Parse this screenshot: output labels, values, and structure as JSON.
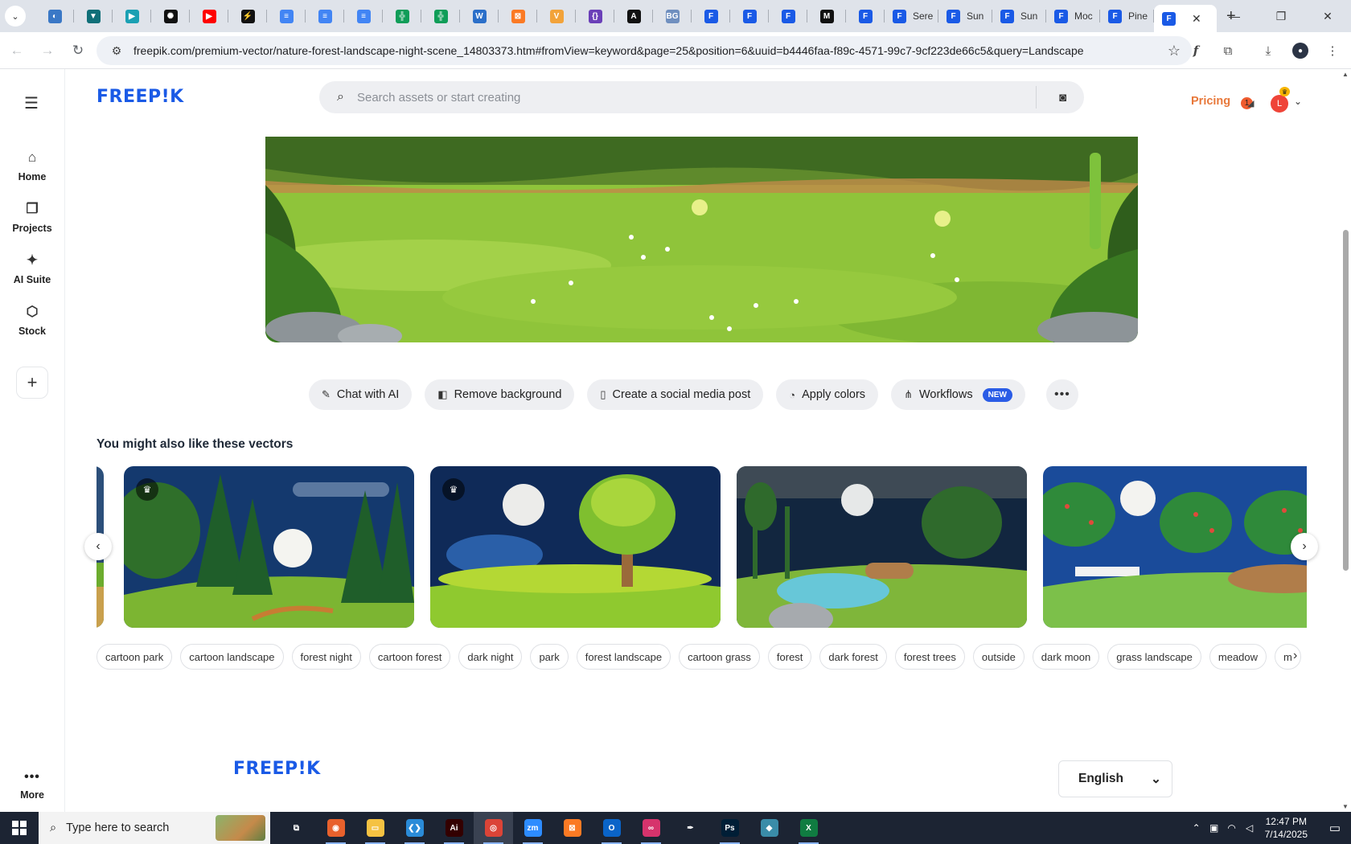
{
  "browser": {
    "pinned_tabs": [
      {
        "icon": "globe-icon",
        "color": "#3a78c6",
        "glyph": "◐"
      },
      {
        "icon": "shield-icon",
        "color": "#0f6f78",
        "glyph": "▼"
      },
      {
        "icon": "arrow-icon",
        "color": "#1aa0b3",
        "glyph": "▶"
      },
      {
        "icon": "openai-icon",
        "color": "#111111",
        "glyph": "✺"
      },
      {
        "icon": "youtube-icon",
        "color": "#ff0000",
        "glyph": "▶"
      },
      {
        "icon": "bolt-icon",
        "color": "#111111",
        "glyph": "⚡"
      },
      {
        "icon": "docs-icon",
        "color": "#4285f4",
        "glyph": "≡"
      },
      {
        "icon": "docs-icon",
        "color": "#4285f4",
        "glyph": "≡"
      },
      {
        "icon": "docs-icon",
        "color": "#4285f4",
        "glyph": "≡"
      },
      {
        "icon": "sheets-icon",
        "color": "#0f9d58",
        "glyph": "╬"
      },
      {
        "icon": "sheets-icon",
        "color": "#0f9d58",
        "glyph": "╬"
      },
      {
        "icon": "word-icon",
        "color": "#2b6fc9",
        "glyph": "W"
      },
      {
        "icon": "xampp-icon",
        "color": "#fb7a24",
        "glyph": "⊠"
      },
      {
        "icon": "v-icon",
        "color": "#f2a33a",
        "glyph": "V"
      },
      {
        "icon": "json-icon",
        "color": "#6a3fb8",
        "glyph": "{}"
      },
      {
        "icon": "a-icon",
        "color": "#111111",
        "glyph": "A"
      },
      {
        "icon": "bg-icon",
        "color": "#6f8fbf",
        "glyph": "BG"
      },
      {
        "icon": "freepik-icon",
        "color": "#1a5ae6",
        "glyph": "F"
      },
      {
        "icon": "freepik-icon",
        "color": "#1a5ae6",
        "glyph": "F"
      },
      {
        "icon": "freepik-icon",
        "color": "#1a5ae6",
        "glyph": "F"
      },
      {
        "icon": "m-icon",
        "color": "#111111",
        "glyph": "M"
      },
      {
        "icon": "freepik-icon",
        "color": "#1a5ae6",
        "glyph": "F"
      }
    ],
    "named_tabs": [
      {
        "label": "Sere",
        "icon": "freepik-icon"
      },
      {
        "label": "Sun",
        "icon": "freepik-icon"
      },
      {
        "label": "Sun",
        "icon": "freepik-icon"
      },
      {
        "label": "Moc",
        "icon": "freepik-icon"
      },
      {
        "label": "Pine",
        "icon": "freepik-icon"
      }
    ],
    "url": "freepik.com/premium-vector/nature-forest-landscape-night-scene_14803373.htm#fromView=keyword&page=25&position=6&uuid=b4446faa-f89c-4571-99c7-9cf223de66c5&query=Landscape"
  },
  "site": {
    "logo": "FREEP!K",
    "search_placeholder": "Search assets or start creating",
    "pricing": "Pricing",
    "notif_count": "1",
    "avatar_letter": "L"
  },
  "sidebar": {
    "items": [
      {
        "label": "Home",
        "icon": "home-icon",
        "glyph": "⌂"
      },
      {
        "label": "Projects",
        "icon": "projects-icon",
        "glyph": "❐"
      },
      {
        "label": "AI Suite",
        "icon": "sparkle-icon",
        "glyph": "✦"
      },
      {
        "label": "Stock",
        "icon": "shapes-icon",
        "glyph": "⬡"
      }
    ],
    "more": "More"
  },
  "actions": [
    {
      "label": "Chat with AI",
      "icon": "chat-ai-icon",
      "glyph": "✎"
    },
    {
      "label": "Remove background",
      "icon": "remove-bg-icon",
      "glyph": "◧"
    },
    {
      "label": "Create a social media post",
      "icon": "phone-icon",
      "glyph": "▯"
    },
    {
      "label": "Apply colors",
      "icon": "palette-icon",
      "glyph": "◔"
    },
    {
      "label": "Workflows",
      "icon": "workflow-icon",
      "glyph": "⋔",
      "badge": "NEW"
    }
  ],
  "related": {
    "title": "You might also like these vectors"
  },
  "tags": [
    "cartoon park",
    "cartoon landscape",
    "forest night",
    "cartoon forest",
    "dark night",
    "park",
    "forest landscape",
    "cartoon grass",
    "forest",
    "dark forest",
    "forest trees",
    "outside",
    "dark moon",
    "grass landscape",
    "meadow",
    "m"
  ],
  "footer": {
    "logo": "FREEP!K",
    "language": "English"
  },
  "taskbar": {
    "search_placeholder": "Type here to search",
    "time": "12:47 PM",
    "date": "7/14/2025",
    "apps": [
      {
        "icon": "task-view-icon",
        "color": "transparent",
        "glyph": "⧉"
      },
      {
        "icon": "firefox-icon",
        "color": "#e8612c",
        "glyph": "◉"
      },
      {
        "icon": "file-explorer-icon",
        "color": "#f5c242",
        "glyph": "▭"
      },
      {
        "icon": "vscode-icon",
        "color": "#2a8bd8",
        "glyph": "❮❯"
      },
      {
        "icon": "illustrator-icon",
        "color": "#330000",
        "glyph": "Ai"
      },
      {
        "icon": "chrome-icon",
        "color": "#db4437",
        "glyph": "◎"
      },
      {
        "icon": "zoom-icon",
        "color": "#2d8cff",
        "glyph": "zm"
      },
      {
        "icon": "xampp-icon",
        "color": "#fb7a24",
        "glyph": "⊠"
      },
      {
        "icon": "outlook-icon",
        "color": "#0a64c8",
        "glyph": "O"
      },
      {
        "icon": "creative-cloud-icon",
        "color": "#d6336c",
        "glyph": "∞"
      },
      {
        "icon": "pen-icon",
        "color": "transparent",
        "glyph": "✒"
      },
      {
        "icon": "photoshop-icon",
        "color": "#001e36",
        "glyph": "Ps"
      },
      {
        "icon": "app-icon",
        "color": "#3a8ca8",
        "glyph": "◆"
      },
      {
        "icon": "excel-icon",
        "color": "#107c41",
        "glyph": "X"
      }
    ]
  },
  "colors": {
    "brand": "#1a5ae6",
    "pricing": "#e8783a",
    "new_badge": "#2a5ce6"
  }
}
